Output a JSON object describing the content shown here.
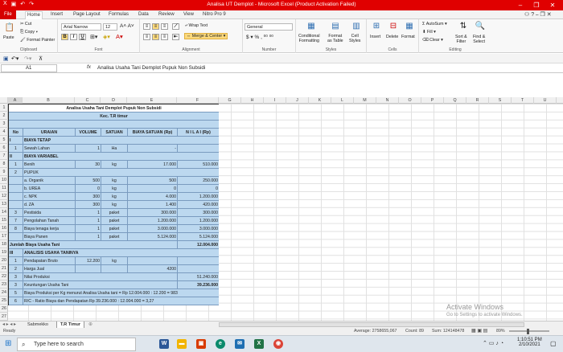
{
  "window": {
    "title": "Analisa UT Demplot - Microsoft Excel (Product Activation Failed)"
  },
  "tabs": [
    "File",
    "Home",
    "Insert",
    "Page Layout",
    "Formulas",
    "Data",
    "Review",
    "View",
    "Nitro Pro 9"
  ],
  "ribbon": {
    "clipboard": {
      "paste": "Paste",
      "cut": "Cut",
      "copy": "Copy",
      "format_painter": "Format Painter",
      "label": "Clipboard"
    },
    "font": {
      "name": "Arial Narrow",
      "size": "12",
      "label": "Font"
    },
    "alignment": {
      "wrap": "Wrap Text",
      "merge": "Merge & Center",
      "label": "Alignment"
    },
    "number": {
      "format": "General",
      "label": "Number"
    },
    "styles": {
      "cond": "Conditional",
      "cond2": "Formatting",
      "fmt_table": "Format",
      "fmt_table2": "as Table",
      "cell_styles": "Cell",
      "cell_styles2": "Styles",
      "label": "Styles"
    },
    "cells": {
      "insert": "Insert",
      "delete": "Delete",
      "format": "Format",
      "label": "Cells"
    },
    "editing": {
      "autosum": "AutoSum",
      "fill": "Fill",
      "clear": "Clear",
      "sort": "Sort &",
      "sort2": "Filter",
      "find": "Find &",
      "find2": "Select",
      "label": "Editing"
    }
  },
  "formula_bar": {
    "cell_ref": "A1",
    "fx": "fx",
    "content": "Analisa Usaha Tani Demplot Pupuk Non Subsidi"
  },
  "columns": [
    "A",
    "B",
    "C",
    "D",
    "E",
    "F",
    "G",
    "H",
    "I",
    "J",
    "K",
    "L",
    "M",
    "N",
    "O",
    "P",
    "Q",
    "R",
    "S",
    "T",
    "U"
  ],
  "rows": [
    "1",
    "2",
    "3",
    "4",
    "5",
    "6",
    "7",
    "8",
    "9",
    "10",
    "11",
    "12",
    "13",
    "14",
    "15",
    "16",
    "17",
    "18",
    "19",
    "20",
    "21",
    "22",
    "23",
    "24",
    "25",
    "26",
    "27"
  ],
  "sheet": {
    "title1": "Analisa Usaha Tani Demplot Pupuk Non Subsidi",
    "title2": "Kec. T.R timur",
    "headers": [
      "No",
      "URAIAN",
      "VOLUME",
      "SATUAN",
      "BIAYA SATUAN (Rp)",
      "N I L A I  (Rp)"
    ],
    "r5": [
      "I",
      "BIAYA TETAP"
    ],
    "r6": [
      "1",
      "Sewah Lahan",
      "1",
      "Ha",
      "-"
    ],
    "r7": [
      "II",
      "BIAYA VARIABEL"
    ],
    "r8": [
      "1",
      "Benih",
      "30",
      "kg",
      "17.000",
      "510.000"
    ],
    "r9": [
      "2",
      "PUPUK"
    ],
    "r10": [
      "a. Organik",
      "500",
      "kg",
      "500",
      "250.000"
    ],
    "r11": [
      "b. UREA",
      "0",
      "kg",
      "0",
      "0"
    ],
    "r12": [
      "c. NPK",
      "300",
      "kg",
      "4.000",
      "1.200.000"
    ],
    "r13": [
      "d. ZA",
      "300",
      "kg",
      "1.400",
      "420.000"
    ],
    "r14": [
      "3",
      "Pestisida",
      "1",
      "paket",
      "300.000",
      "300.000"
    ],
    "r15": [
      "7",
      "Pengolahan Tanah",
      "1",
      "paket",
      "1.200.000",
      "1.200.000"
    ],
    "r16": [
      "8",
      "Biaya tenaga kerja",
      "1",
      "paket",
      "3.000.000",
      "3.000.000"
    ],
    "r17": [
      "Biaya Panen",
      "1",
      "paket",
      "5.124.000",
      "5.124.000"
    ],
    "r18": [
      "Jumlah Biaya Usaha Tani",
      "12.004.000"
    ],
    "r19": [
      "III",
      "ANALISIS USAHA TANINYA"
    ],
    "r20": [
      "1",
      "Pendapatan Bruto",
      "12.200",
      "kg"
    ],
    "r21": [
      "2",
      "Harga Jual",
      "4200"
    ],
    "r22": [
      "3",
      "Nilai Produksi",
      "51.240.000"
    ],
    "r23": [
      "3",
      "Keuntungan Usaha Tani",
      "39.236.000"
    ],
    "r24": [
      "5",
      "Biaya Produksi per Kg menurut Analisa Usaha tani = Rp 12.004.000 : 12.200 = 983"
    ],
    "r25": [
      "6",
      "R/C - Ratio Biaya dan Pendapatan Rp 39.236.000 : 12.004.000 = 3,27"
    ]
  },
  "sheet_tabs": [
    "Sabmekko",
    "T.R Timur"
  ],
  "status": {
    "ready": "Ready",
    "average": "Average: 2758655,067",
    "count": "Count: 89",
    "sum": "Sum: 124148478",
    "zoom": "89%"
  },
  "taskbar": {
    "search": "Type here to search",
    "time": "1:10:51 PM",
    "date": "2/10/2021"
  },
  "watermark": {
    "line1": "Activate Windows",
    "line2": "Go to Settings to activate Windows."
  },
  "colors": {
    "title_bar": "#e00000",
    "table_fill": "#bcd8ef",
    "file_tab": "#d50000"
  }
}
